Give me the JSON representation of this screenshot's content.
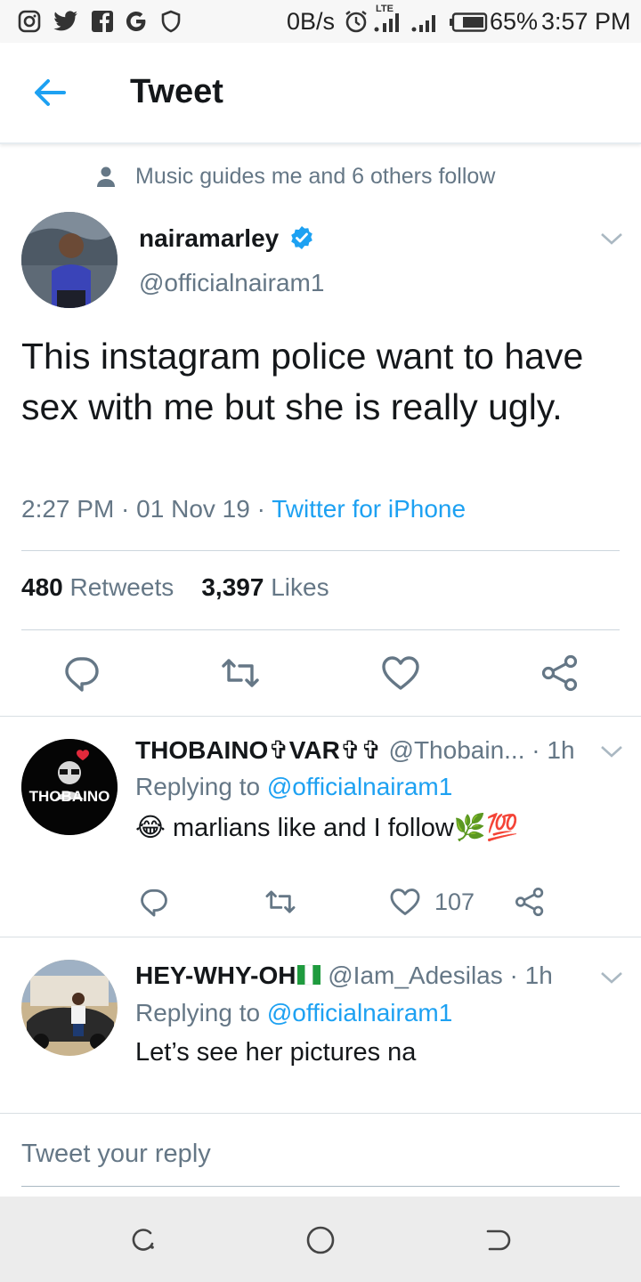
{
  "status_bar": {
    "speed": "0B/s",
    "network": "LTE",
    "battery": "65%",
    "time": "3:57 PM",
    "icons": [
      "instagram-icon",
      "twitter-icon",
      "facebook-icon",
      "google-icon",
      "shield-icon",
      "alarm-icon",
      "signal-icon",
      "battery-icon"
    ]
  },
  "header": {
    "title": "Tweet",
    "back_icon": "arrow-left-icon"
  },
  "context": {
    "text": "Music guides me and 6 others follow",
    "icon": "person-icon"
  },
  "tweet": {
    "name": "nairamarley",
    "verified": true,
    "handle": "@officialnairam1",
    "text": "This instagram police want to have sex with me but she is really ugly.",
    "time": "2:27 PM",
    "date": "01 Nov 19",
    "source": "Twitter for iPhone",
    "retweets_count": "480",
    "retweets_label": "Retweets",
    "likes_count": "3,397",
    "likes_label": "Likes",
    "actions": [
      "reply-icon",
      "retweet-icon",
      "like-icon",
      "share-icon"
    ]
  },
  "replies": [
    {
      "name": "THOBAINO✞VAR✞✞",
      "handle": "@Thobain...",
      "time": "1h",
      "replying_prefix": "Replying to",
      "replying_to": "@officialnairam1",
      "text": "marlians like and I follow",
      "emoji_prefix": "😂",
      "emoji_suffix": "🌿💯",
      "avatar_label": "THOBAINO",
      "likes": "107"
    },
    {
      "name": "HEY-WHY-OH",
      "handle": "@Iam_Adesilas",
      "time": "1h",
      "replying_prefix": "Replying to",
      "replying_to": "@officialnairam1",
      "text": "Let’s see her pictures na"
    }
  ],
  "composer": {
    "placeholder": "Tweet your reply"
  },
  "colors": {
    "accent": "#1da1f2",
    "muted": "#657786",
    "text": "#14171a"
  }
}
